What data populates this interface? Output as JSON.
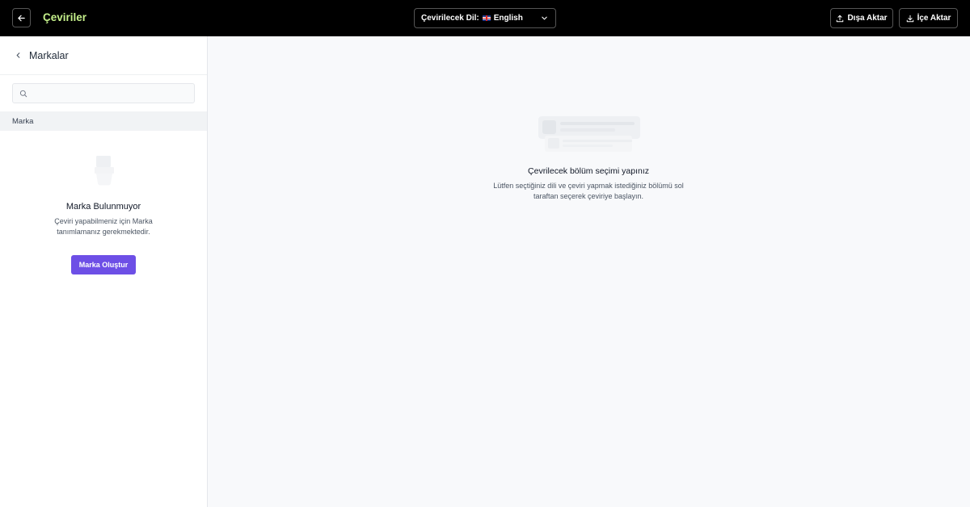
{
  "header": {
    "title": "Çeviriler",
    "language_label": "Çevirilecek Dil:",
    "language_value": "English",
    "export_label": "Dışa Aktar",
    "import_label": "İçe Aktar"
  },
  "sidebar": {
    "back_title": "Markalar",
    "search_placeholder": "",
    "section_label": "Marka",
    "empty_title": "Marka Bulunmuyor",
    "empty_description": "Çeviri yapabilmeniz için Marka tanımlamanız gerekmektedir.",
    "create_button": "Marka Oluştur"
  },
  "main": {
    "empty_title": "Çevrilecek bölüm seçimi yapınız",
    "empty_description": "Lütfen seçtiğiniz dili ve çeviri yapmak istediğiniz bölümü sol taraftan seçerek çeviriye başlayın."
  },
  "icons": {
    "back": "arrow-left-icon",
    "chevron_left": "chevron-left-icon",
    "chevron_down": "chevron-down-icon",
    "export": "upload-icon",
    "import": "download-icon",
    "search": "search-icon",
    "flag": "uk-flag-icon"
  },
  "colors": {
    "topbar_bg": "#000000",
    "title_accent": "#c5f08b",
    "primary_button": "#6d4fe6",
    "main_bg": "#f8f9fb"
  }
}
